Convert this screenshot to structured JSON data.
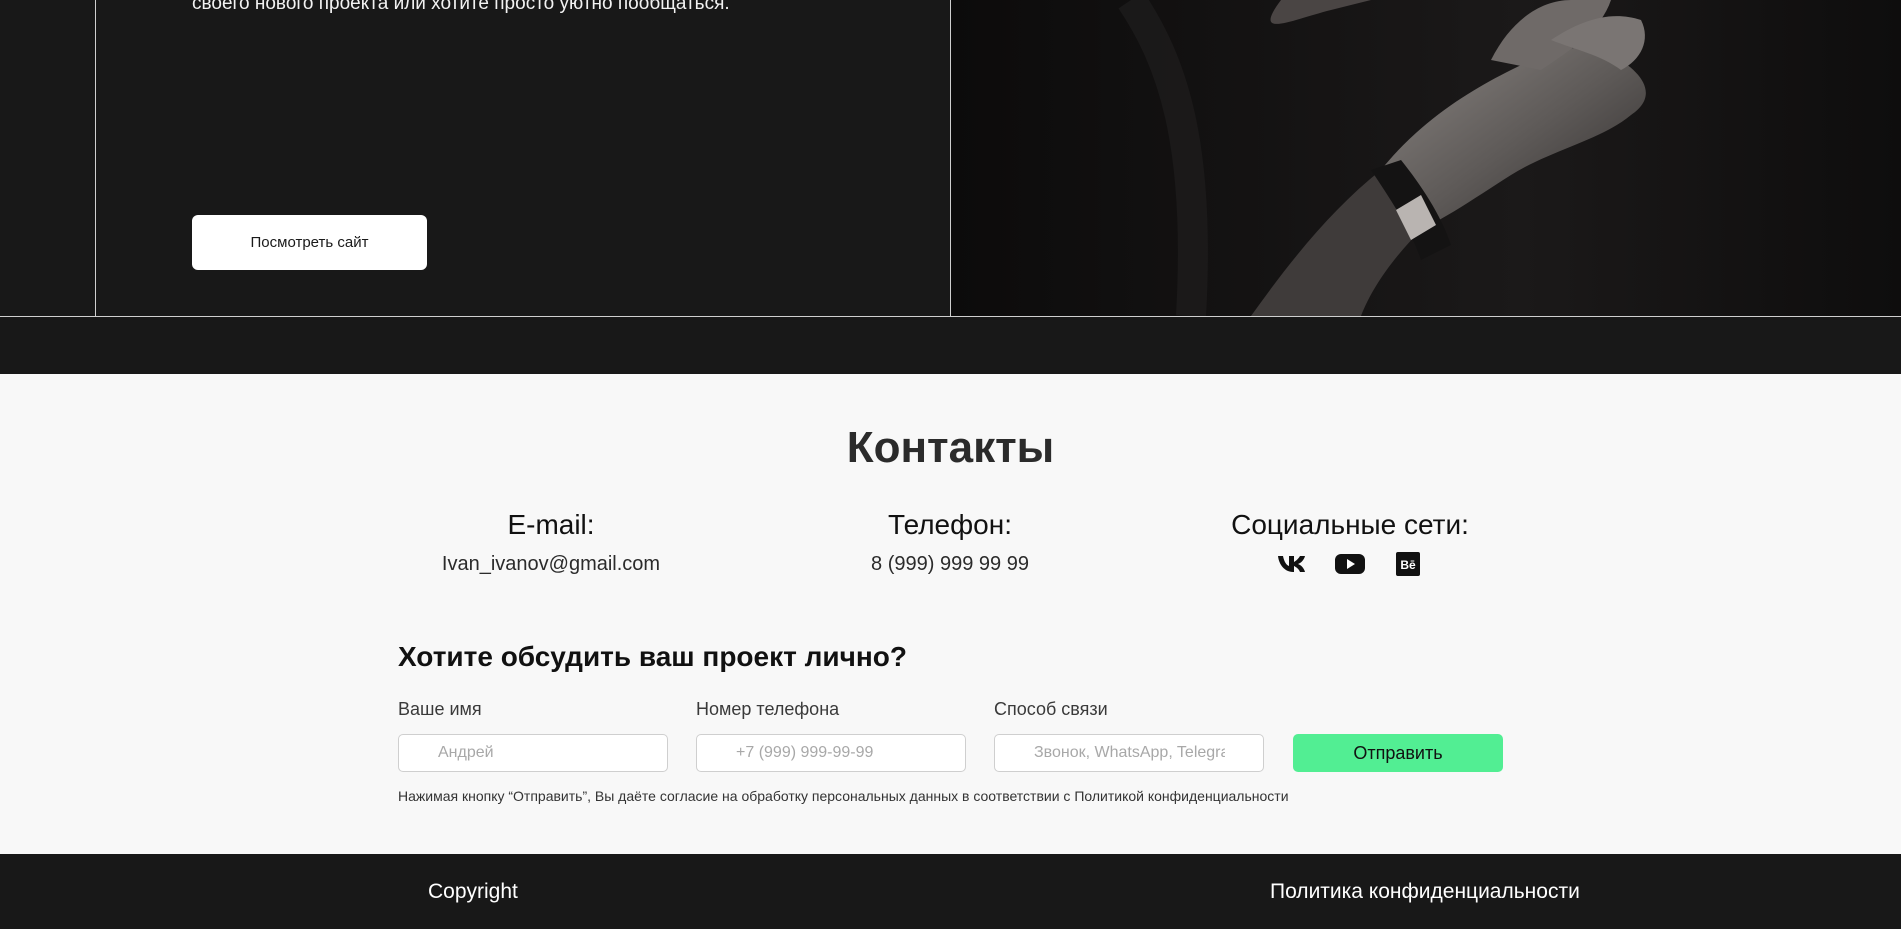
{
  "hero": {
    "text": "своего нового проекта или хотите просто уютно пообщаться.",
    "button_label": "Посмотреть сайт"
  },
  "contacts": {
    "title": "Контакты",
    "email": {
      "heading": "E-mail:",
      "value": "Ivan_ivanov@gmail.com"
    },
    "phone": {
      "heading": "Телефон:",
      "value": "8 (999) 999 99 99"
    },
    "social": {
      "heading": "Социальные сети:",
      "icons": [
        "vk-icon",
        "youtube-icon",
        "behance-icon"
      ]
    }
  },
  "form": {
    "title": "Хотите обсудить ваш проект лично?",
    "name": {
      "label": "Ваше имя",
      "placeholder": "Андрей"
    },
    "phone": {
      "label": "Номер телефона",
      "placeholder": "+7 (999) 999-99-99"
    },
    "method": {
      "label": "Способ связи",
      "placeholder": "Звонок, WhatsApp, Telegram"
    },
    "submit_label": "Отправить",
    "consent": "Нажимая кнопку “Отправить”, Вы даёте согласие на обработку персональных данных в соответствии с Политикой конфиденциальности"
  },
  "footer": {
    "copyright": "Copyright",
    "policy": "Политика конфиденциальности"
  },
  "colors": {
    "dark_bg": "#181818",
    "light_bg": "#f8f8f8",
    "accent_green": "#52ee93"
  }
}
